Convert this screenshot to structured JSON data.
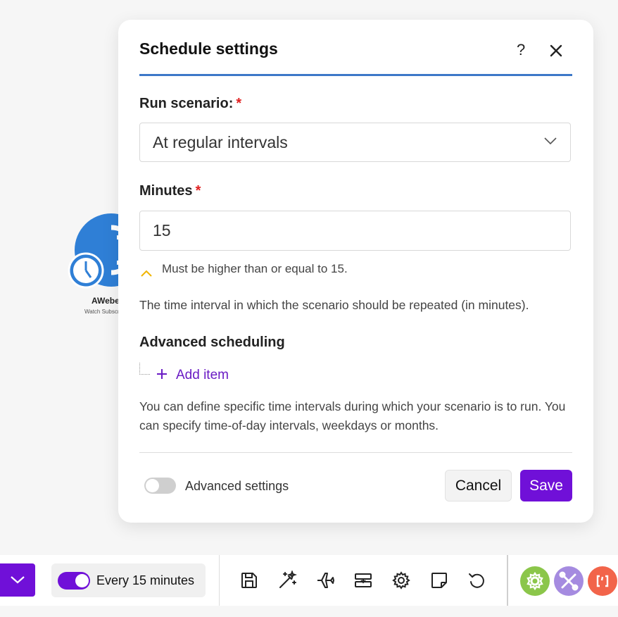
{
  "module": {
    "name": "AWeber",
    "subtitle": "Watch Subscribers",
    "brand_color": "#2f7fd6"
  },
  "dialog": {
    "title": "Schedule settings",
    "help_label": "?",
    "run_scenario": {
      "label": "Run scenario:",
      "required_mark": "*",
      "selected": "At regular intervals"
    },
    "minutes": {
      "label": "Minutes",
      "required_mark": "*",
      "value": "15",
      "hint": "Must be higher than or equal to 15.",
      "description": "The time interval in which the scenario should be repeated (in minutes)."
    },
    "advanced_scheduling": {
      "label": "Advanced scheduling",
      "add_item": "Add item",
      "description": "You can define specific time intervals during which your scenario is to run. You can specify time-of-day intervals, weekdays or months."
    },
    "advanced_settings": {
      "label": "Advanced settings",
      "enabled": false
    },
    "cancel_label": "Cancel",
    "save_label": "Save"
  },
  "toolbar": {
    "schedule_label": "Every 15 minutes",
    "schedule_enabled": true,
    "tools": [
      "save-icon",
      "magic-wand-icon",
      "airplane-icon",
      "flow-control-icon",
      "gear-icon",
      "note-icon",
      "undo-icon"
    ],
    "right_icons": [
      "tools-gear-icon",
      "flow-tools-icon",
      "text-parser-icon"
    ]
  },
  "colors": {
    "accent": "#7010d8",
    "title_rule": "#3d78c8",
    "required": "#e02020",
    "hint_caret": "#f0b400",
    "tools_green": "#8bc64a",
    "flow_purple": "#a58be0",
    "parser_orange": "#f2644a"
  }
}
